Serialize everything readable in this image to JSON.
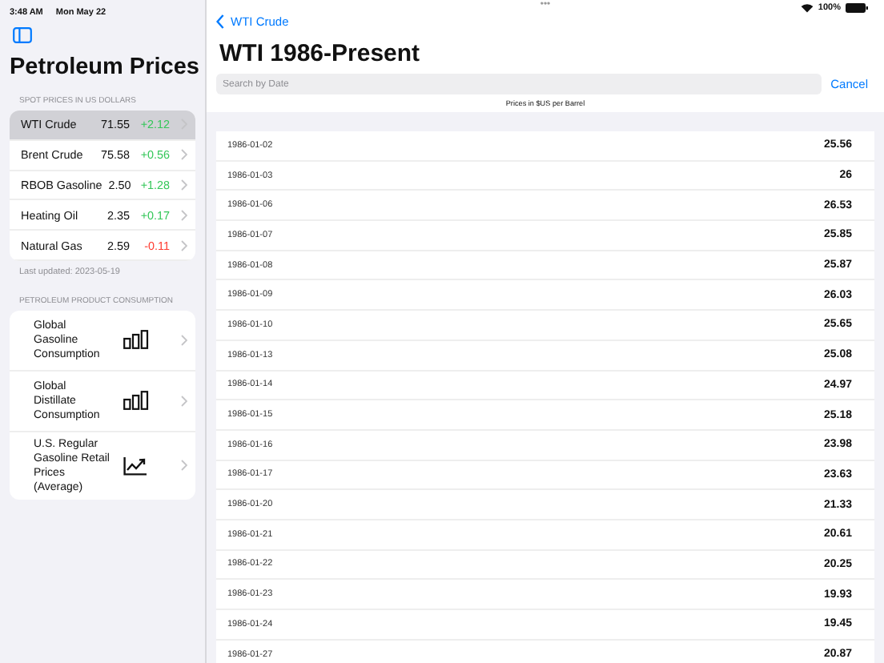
{
  "status_bar": {
    "time": "3:48 AM",
    "date": "Mon May 22",
    "dots": "•••",
    "battery": "100%"
  },
  "sidebar": {
    "title": "Petroleum Prices",
    "spot_header": "SPOT PRICES IN US DOLLARS",
    "spot_prices": [
      {
        "name": "WTI Crude",
        "price": "71.55",
        "change": "+2.12",
        "color": "#34c759",
        "selected": true
      },
      {
        "name": "Brent Crude",
        "price": "75.58",
        "change": "+0.56",
        "color": "#34c759",
        "selected": false
      },
      {
        "name": "RBOB Gasoline",
        "price": "2.50",
        "change": "+1.28",
        "color": "#34c759",
        "selected": false
      },
      {
        "name": "Heating Oil",
        "price": "2.35",
        "change": "+0.17",
        "color": "#34c759",
        "selected": false
      },
      {
        "name": "Natural Gas",
        "price": "2.59",
        "change": "-0.11",
        "color": "#ff3b30",
        "selected": false
      }
    ],
    "last_updated": "Last updated: 2023-05-19",
    "consumption_header": "PETROLEUM PRODUCT CONSUMPTION",
    "consumption": [
      {
        "label": "Global Gasoline Consumption",
        "kind": "bars"
      },
      {
        "label": "Global Distillate Consumption",
        "kind": "bars"
      },
      {
        "label": "U.S. Regular Gasoline Retail Prices (Average)",
        "kind": "trend"
      }
    ]
  },
  "detail": {
    "back": "WTI Crude",
    "title": "WTI 1986-Present",
    "search": {
      "placeholder": "Search by Date"
    },
    "cancel": "Cancel",
    "caption": "Prices in $US per Barrel",
    "rows": [
      {
        "date": "1986-01-02",
        "price": "25.56"
      },
      {
        "date": "1986-01-03",
        "price": "26"
      },
      {
        "date": "1986-01-06",
        "price": "26.53"
      },
      {
        "date": "1986-01-07",
        "price": "25.85"
      },
      {
        "date": "1986-01-08",
        "price": "25.87"
      },
      {
        "date": "1986-01-09",
        "price": "26.03"
      },
      {
        "date": "1986-01-10",
        "price": "25.65"
      },
      {
        "date": "1986-01-13",
        "price": "25.08"
      },
      {
        "date": "1986-01-14",
        "price": "24.97"
      },
      {
        "date": "1986-01-15",
        "price": "25.18"
      },
      {
        "date": "1986-01-16",
        "price": "23.98"
      },
      {
        "date": "1986-01-17",
        "price": "23.63"
      },
      {
        "date": "1986-01-20",
        "price": "21.33"
      },
      {
        "date": "1986-01-21",
        "price": "20.61"
      },
      {
        "date": "1986-01-22",
        "price": "20.25"
      },
      {
        "date": "1986-01-23",
        "price": "19.93"
      },
      {
        "date": "1986-01-24",
        "price": "19.45"
      },
      {
        "date": "1986-01-27",
        "price": "20.87"
      }
    ]
  }
}
